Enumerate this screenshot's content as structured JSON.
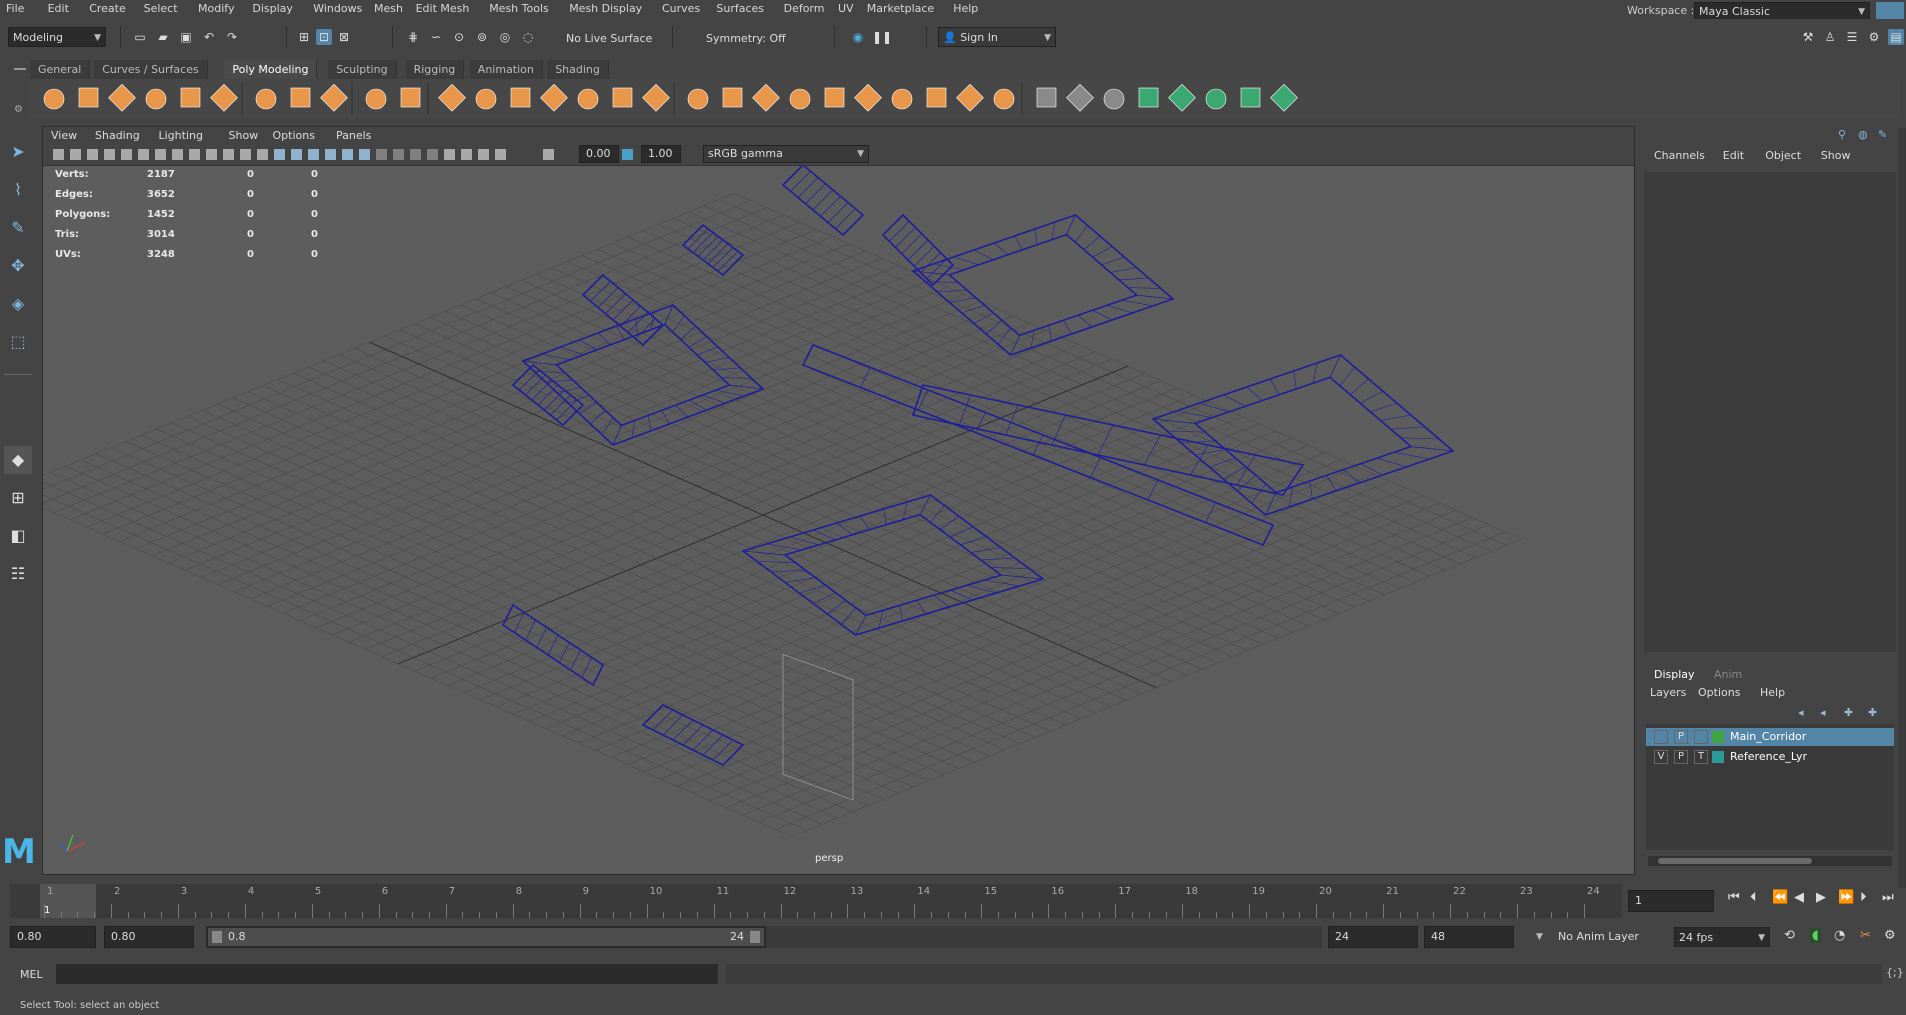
{
  "menubar": {
    "items": [
      "File",
      "Edit",
      "Create",
      "Select",
      "Modify",
      "Display",
      "Windows",
      "Mesh",
      "Edit Mesh",
      "Mesh Tools",
      "Mesh Display",
      "Curves",
      "Surfaces",
      "Deform",
      "UV",
      "Marketplace",
      "Help"
    ],
    "workspace_label": "Workspace :",
    "workspace_value": "Maya Classic"
  },
  "statusline": {
    "mode": "Modeling",
    "live_surface": "No Live Surface",
    "symmetry": "Symmetry: Off",
    "sign_in": "Sign In"
  },
  "shelf": {
    "tabs": [
      "General",
      "Curves / Surfaces",
      "Poly Modeling",
      "Sculpting",
      "Rigging",
      "Animation",
      "Shading"
    ],
    "active_tab": "Poly Modeling",
    "accent": "#e8964a"
  },
  "viewport": {
    "menus": [
      "View",
      "Shading",
      "Lighting",
      "Show",
      "Options",
      "Panels"
    ],
    "exposure": "0.00",
    "gamma": "1.00",
    "color_space": "sRGB gamma",
    "camera": "persp",
    "hud": [
      {
        "label": "Verts:",
        "v1": "2187",
        "v2": "0",
        "v3": "0"
      },
      {
        "label": "Edges:",
        "v1": "3652",
        "v2": "0",
        "v3": "0"
      },
      {
        "label": "Polygons:",
        "v1": "1452",
        "v2": "0",
        "v3": "0"
      },
      {
        "label": "Tris:",
        "v1": "3014",
        "v2": "0",
        "v3": "0"
      },
      {
        "label": "UVs:",
        "v1": "3248",
        "v2": "0",
        "v3": "0"
      }
    ],
    "wire_color": "#1f1f9a",
    "background": "#5d5d5d"
  },
  "channelbox": {
    "menus": [
      "Channels",
      "Edit",
      "Object",
      "Show"
    ]
  },
  "layers": {
    "tabs": [
      "Display",
      "Anim"
    ],
    "menus": [
      "Layers",
      "Options",
      "Help"
    ],
    "rows": [
      {
        "v": "",
        "p": "P",
        "t": "",
        "name": "Main_Corridor",
        "color": "#3fa33f",
        "selected": true
      },
      {
        "v": "V",
        "p": "P",
        "t": "T",
        "name": "Reference_Lyr",
        "color": "#2a9a9a",
        "selected": false
      }
    ]
  },
  "timeslider": {
    "ticks": [
      "1",
      "2",
      "3",
      "4",
      "5",
      "6",
      "7",
      "8",
      "9",
      "10",
      "11",
      "12",
      "13",
      "14",
      "15",
      "16",
      "17",
      "18",
      "19",
      "20",
      "21",
      "22",
      "23",
      "24"
    ],
    "current_frame": "1",
    "current_frame_field": "1"
  },
  "range": {
    "start_field": "0.80",
    "start_playback": "0.80",
    "slider_start": "0.8",
    "slider_end": "24",
    "end_playback": "24",
    "end_field": "48",
    "anim_layer": "No Anim Layer",
    "fps": "24 fps"
  },
  "mel": {
    "label": "MEL"
  },
  "helpline": {
    "text": "Select Tool: select an object"
  }
}
